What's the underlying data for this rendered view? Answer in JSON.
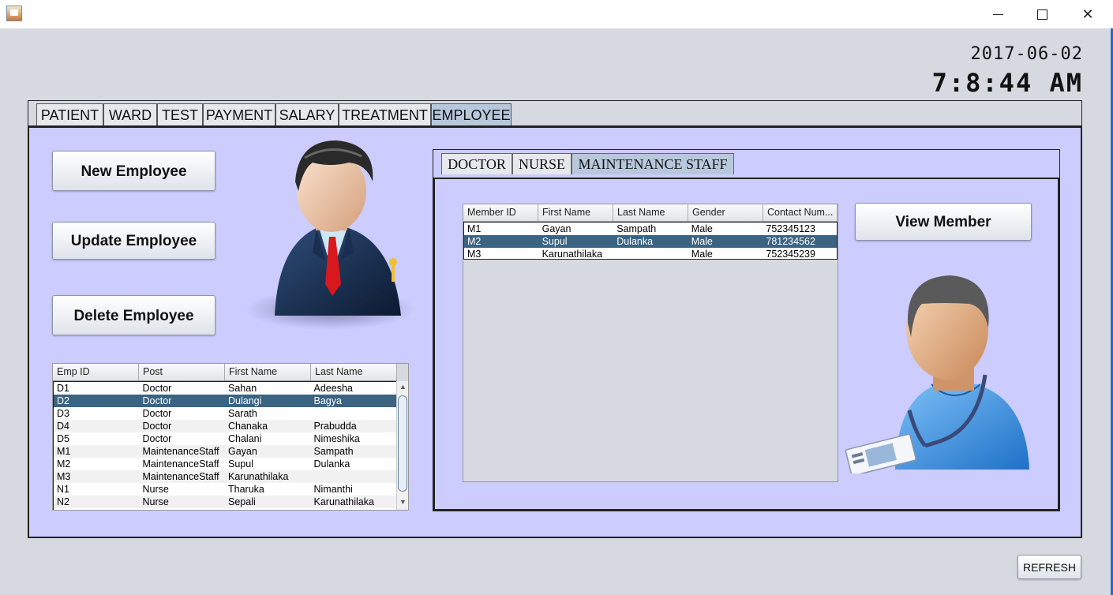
{
  "clock": {
    "date": "2017-06-02",
    "time": "7:8:44 AM"
  },
  "main_tabs": [
    {
      "label": "PATIENT"
    },
    {
      "label": "WARD"
    },
    {
      "label": "TEST"
    },
    {
      "label": "PAYMENT"
    },
    {
      "label": "SALARY"
    },
    {
      "label": "TREATMENT"
    },
    {
      "label": "EMPLOYEE"
    }
  ],
  "active_main_tab": "EMPLOYEE",
  "buttons": {
    "new_employee": "New Employee",
    "update_employee": "Update Employee",
    "delete_employee": "Delete Employee",
    "view_member": "View Member",
    "refresh": "REFRESH"
  },
  "employee_table": {
    "columns": [
      "Emp ID",
      "Post",
      "First Name",
      "Last Name"
    ],
    "rows": [
      [
        "D1",
        "Doctor",
        "Sahan",
        "Adeesha"
      ],
      [
        "D2",
        "Doctor",
        "Dulangi",
        "Bagya"
      ],
      [
        "D3",
        "Doctor",
        "Sarath",
        ""
      ],
      [
        "D4",
        "Doctor",
        "Chanaka",
        "Prabudda"
      ],
      [
        "D5",
        "Doctor",
        "Chalani",
        "Nimeshika"
      ],
      [
        "M1",
        "MaintenanceStaff",
        "Gayan",
        "Sampath"
      ],
      [
        "M2",
        "MaintenanceStaff",
        "Supul",
        "Dulanka"
      ],
      [
        "M3",
        "MaintenanceStaff",
        "Karunathilaka",
        ""
      ],
      [
        "N1",
        "Nurse",
        "Tharuka",
        "Nimanthi"
      ],
      [
        "N2",
        "Nurse",
        "Sepali",
        "Karunathilaka"
      ]
    ],
    "selected_row": 1
  },
  "sub_tabs": [
    {
      "label": "DOCTOR"
    },
    {
      "label": "NURSE"
    },
    {
      "label": "MAINTENANCE STAFF"
    }
  ],
  "active_sub_tab": "MAINTENANCE STAFF",
  "member_table": {
    "columns": [
      "Member ID",
      "First Name",
      "Last Name",
      "Gender",
      "Contact Num..."
    ],
    "rows": [
      [
        "M1",
        "Gayan",
        "Sampath",
        "Male",
        "752345123"
      ],
      [
        "M2",
        "Supul",
        "Dulanka",
        "Male",
        "781234562"
      ],
      [
        "M3",
        "Karunathilaka",
        "",
        "Male",
        "752345239"
      ]
    ],
    "selected_row": 1
  },
  "colors": {
    "panel_bg": "#ccccff",
    "window_bg": "#d6d9e0",
    "selection": "#3b6382",
    "active_tab": "#b8c8dc"
  },
  "icons": {
    "app": "java-app-icon",
    "manager": "businessman-avatar-icon",
    "staff": "staff-with-badge-avatar-icon"
  }
}
